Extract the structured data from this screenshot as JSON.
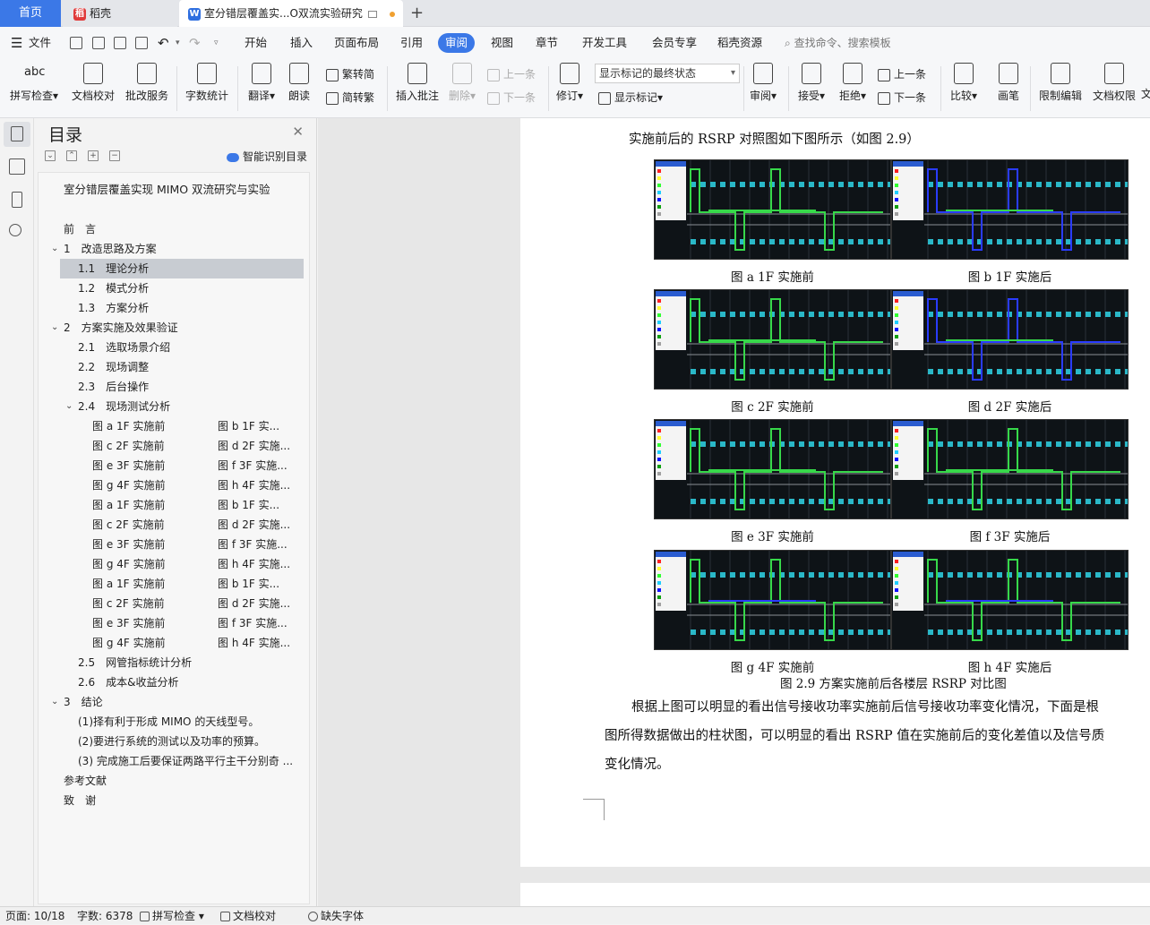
{
  "tabs": {
    "home": "首页",
    "daoke": "稻壳",
    "doc": "室分错层覆盖实...O双流实验研究",
    "add": "+"
  },
  "menu": {
    "file": "文件",
    "items": [
      "开始",
      "插入",
      "页面布局",
      "引用",
      "审阅",
      "视图",
      "章节",
      "开发工具",
      "会员专享",
      "稻壳资源"
    ],
    "active_index": 4,
    "search": "查找命令、搜索模板"
  },
  "ribbon": {
    "spell": "拼写检查",
    "proofread": "文档校对",
    "batch": "批改服务",
    "wordcount": "字数统计",
    "translate": "翻译",
    "read": "朗读",
    "to_trad": "繁转简",
    "to_simp": "简转繁",
    "insert_comment": "插入批注",
    "delete": "删除",
    "prev": "上一条",
    "next": "下一条",
    "revise": "修订",
    "status_select": "显示标记的最终状态",
    "show_marks": "显示标记",
    "review": "审阅",
    "accept": "接受",
    "reject": "拒绝",
    "prev2": "上一条",
    "next2": "下一条",
    "compare": "比较",
    "pen": "画笔",
    "restrict": "限制编辑",
    "rights": "文档权限",
    "cut": "文"
  },
  "toc": {
    "title": "目录",
    "smart": "智能识别目录",
    "doc_title": "室分错层覆盖实现 MIMO 双流研究与实验",
    "items": [
      {
        "text": "前　言",
        "level": 0
      },
      {
        "text": "1　改造思路及方案",
        "level": 0,
        "arrow": true
      },
      {
        "text": "1.1　理论分析",
        "level": 1,
        "selected": true
      },
      {
        "text": "1.2　模式分析",
        "level": 1
      },
      {
        "text": "1.3　方案分析",
        "level": 1
      },
      {
        "text": "2　方案实施及效果验证",
        "level": 0,
        "arrow": true
      },
      {
        "text": "2.1　选取场景介绍",
        "level": 1
      },
      {
        "text": "2.2　现场调整",
        "level": 1
      },
      {
        "text": "2.3　后台操作",
        "level": 1
      },
      {
        "text": "2.4　现场测试分析",
        "level": 1,
        "arrow": true
      },
      {
        "text": "图 a 1F 实施前",
        "right": "图 b 1F 实...",
        "level": 2
      },
      {
        "text": "图 c 2F 实施前",
        "right": "图 d 2F 实施...",
        "level": 2
      },
      {
        "text": "图 e 3F 实施前",
        "right": "图 f 3F 实施...",
        "level": 2
      },
      {
        "text": "图 g 4F 实施前",
        "right": "图 h 4F 实施...",
        "level": 2
      },
      {
        "text": "图 a 1F 实施前",
        "right": "图 b 1F 实...",
        "level": 2
      },
      {
        "text": "图 c 2F 实施前",
        "right": "图 d 2F 实施...",
        "level": 2
      },
      {
        "text": "图 e 3F 实施前",
        "right": "图 f 3F 实施...",
        "level": 2
      },
      {
        "text": "图 g 4F 实施前",
        "right": "图 h 4F 实施...",
        "level": 2
      },
      {
        "text": "图 a 1F 实施前",
        "right": "图 b 1F 实...",
        "level": 2
      },
      {
        "text": "图 c 2F 实施前",
        "right": "图 d 2F 实施...",
        "level": 2
      },
      {
        "text": "图 e 3F 实施前",
        "right": "图 f 3F 实施...",
        "level": 2
      },
      {
        "text": "图 g 4F 实施前",
        "right": "图 h 4F 实施...",
        "level": 2
      },
      {
        "text": "2.5　网管指标统计分析",
        "level": 1
      },
      {
        "text": "2.6　成本&收益分析",
        "level": 1
      },
      {
        "text": "3　结论",
        "level": 0,
        "arrow": true
      },
      {
        "text": "(1)择有利于形成 MIMO 的天线型号。",
        "level": 1
      },
      {
        "text": "(2)要进行系统的测试以及功率的预算。",
        "level": 1
      },
      {
        "text": "(3) 完成施工后要保证两路平行主干分别奇 ...",
        "level": 1
      },
      {
        "text": "参考文献",
        "level": 0
      },
      {
        "text": "致　谢",
        "level": 0
      }
    ]
  },
  "doc": {
    "intro": "实施前后的 RSRP 对照图如下图所示（如图 2.9）",
    "captions": [
      "图 a 1F 实施前",
      "图 b 1F 实施后",
      "图 c 2F 实施前",
      "图 d 2F 实施后",
      "图 e 3F 实施前",
      "图 f 3F 实施后",
      "图 g 4F 实施前",
      "图 h 4F 实施后"
    ],
    "figure_title": "图 2.9  方案实施前后各楼层 RSRP 对比图",
    "para1": "根据上图可以明显的看出信号接收功率实施前后信号接收功率变化情况，下面是根",
    "para2": "图所得数据做出的柱状图，可以明显的看出 RSRP 值在实施前后的变化差值以及信号质",
    "para3": "变化情况。"
  },
  "status": {
    "page": "页面: 10/18",
    "words": "字数: 6378",
    "spell": "拼写检查",
    "proof": "文档校对",
    "font": "缺失字体"
  },
  "colors": {
    "accent": "#3b78e7",
    "daoke_logo": "#e03a3a",
    "doc_logo": "#2f6fe0",
    "plot_bg": "#0e1317",
    "plot_green": "#37d84a",
    "plot_blue": "#2a3cff",
    "plot_cyan": "#2ab8c8"
  }
}
